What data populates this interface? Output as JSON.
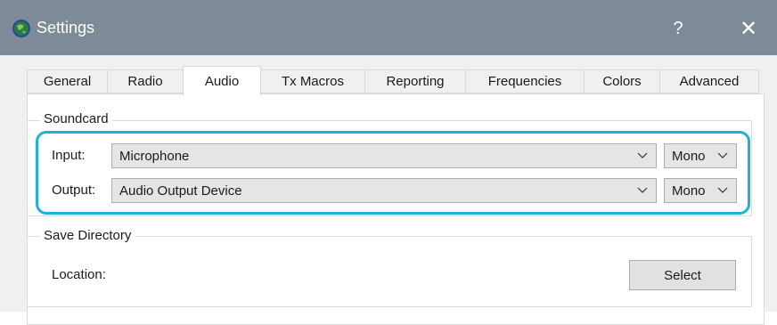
{
  "window": {
    "title": "Settings",
    "help_label": "?",
    "close_label": "✕"
  },
  "tabs": [
    {
      "label": "General"
    },
    {
      "label": "Radio"
    },
    {
      "label": "Audio"
    },
    {
      "label": "Tx Macros"
    },
    {
      "label": "Reporting"
    },
    {
      "label": "Frequencies"
    },
    {
      "label": "Colors"
    },
    {
      "label": "Advanced"
    }
  ],
  "active_tab": "Audio",
  "soundcard": {
    "group_label": "Soundcard",
    "input_label": "Input:",
    "input_device": "Microphone",
    "input_channels": "Mono",
    "output_label": "Output:",
    "output_device": "Audio Output Device",
    "output_channels": "Mono"
  },
  "save_directory": {
    "group_label": "Save Directory",
    "location_label": "Location:",
    "select_button": "Select"
  },
  "colors": {
    "titlebar": "#7f8a99",
    "highlight": "#1fb1d6"
  }
}
